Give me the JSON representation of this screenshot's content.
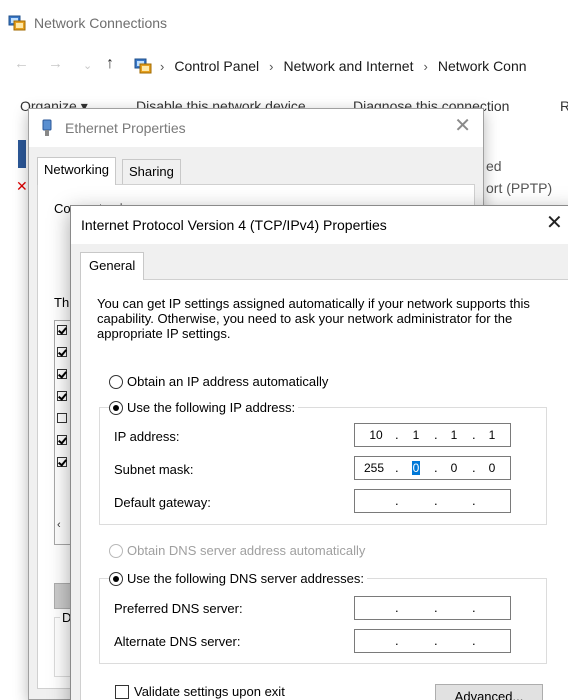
{
  "explorer": {
    "title": "Network Connections",
    "breadcrumbs": [
      "Control Panel",
      "Network and Internet",
      "Network Conn"
    ],
    "toolbar": {
      "organize": "Organize ▾",
      "disable": "Disable this network device",
      "diagnose": "Diagnose this connection",
      "more": "R"
    },
    "bg_text": [
      "ed",
      "ort (PPTP)"
    ]
  },
  "ethernet_dialog": {
    "title": "Ethernet Properties",
    "tabs": [
      "Networking",
      "Sharing"
    ],
    "connect_label": "Connect using:",
    "this_label": "Th",
    "desc_label": "D"
  },
  "ipv4_dialog": {
    "title": "Internet Protocol Version 4 (TCP/IPv4) Properties",
    "tab": "General",
    "intro": "You can get IP settings assigned automatically if your network supports this capability. Otherwise, you need to ask your network administrator for the appropriate IP settings.",
    "ip_auto": "Obtain an IP address automatically",
    "ip_manual": "Use the following IP address:",
    "ip_label": "IP address:",
    "ip_octets": [
      "10",
      "1",
      "1",
      "1"
    ],
    "mask_label": "Subnet mask:",
    "mask_octets": [
      "255",
      "0",
      "0",
      "0"
    ],
    "gateway_label": "Default gateway:",
    "dns_auto": "Obtain DNS server address automatically",
    "dns_manual": "Use the following DNS server addresses:",
    "preferred_label": "Preferred DNS server:",
    "alternate_label": "Alternate DNS server:",
    "validate": "Validate settings upon exit",
    "advanced": "Advanced..."
  },
  "colors": {
    "selection": "#0078d7",
    "dialog_bg": "#f0f0f0"
  }
}
